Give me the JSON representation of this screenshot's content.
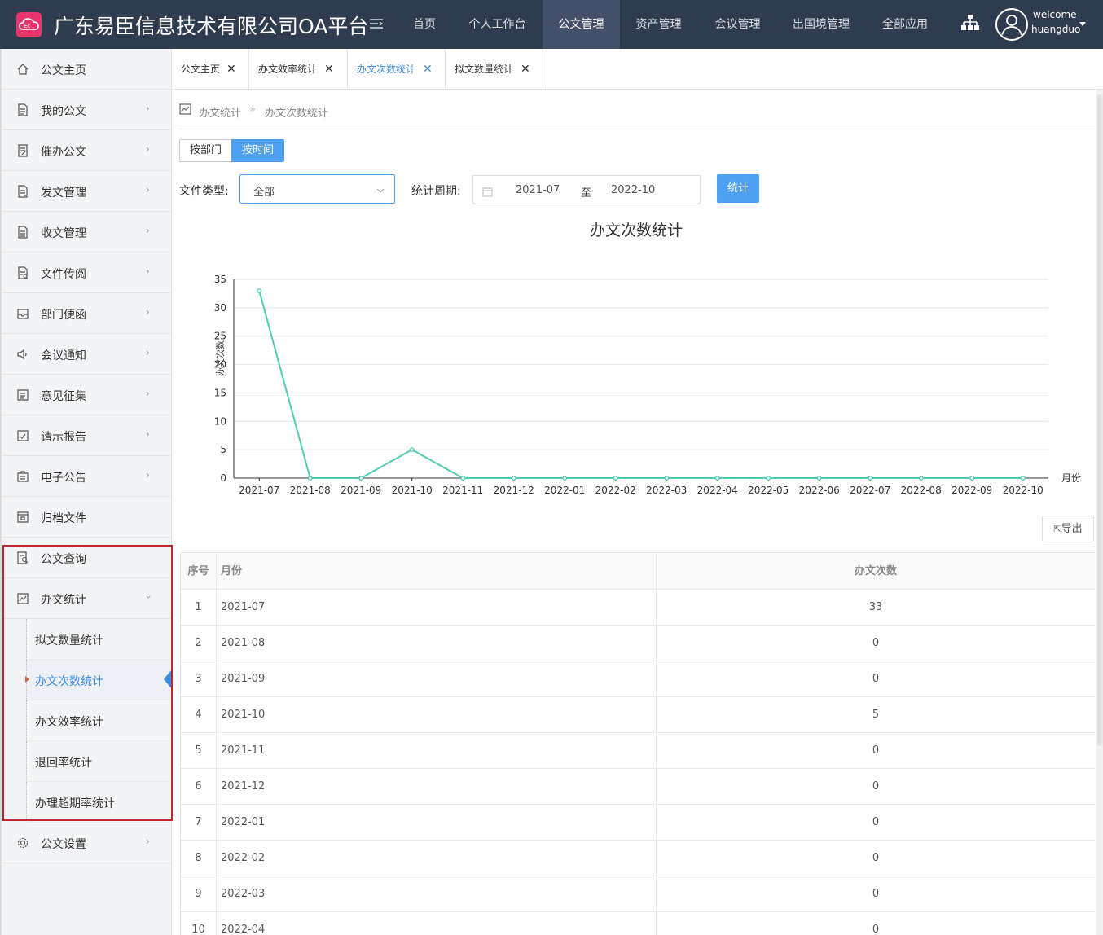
{
  "header": {
    "title": "广东易臣信息技术有限公司OA平台",
    "logo_text": "Ec",
    "nav": [
      "首页",
      "个人工作台",
      "公文管理",
      "资产管理",
      "会议管理",
      "出国境管理",
      "全部应用"
    ],
    "active_nav": "公文管理",
    "welcome": "welcome",
    "username": "huangduo"
  },
  "sidebar": {
    "items": [
      {
        "label": "公文主页",
        "icon": "home-icon"
      },
      {
        "label": "我的公文",
        "icon": "document-icon"
      },
      {
        "label": "催办公文",
        "icon": "edit-document-icon"
      },
      {
        "label": "发文管理",
        "icon": "send-document-icon"
      },
      {
        "label": "收文管理",
        "icon": "receive-document-icon"
      },
      {
        "label": "文件传阅",
        "icon": "circulate-icon"
      },
      {
        "label": "部门便函",
        "icon": "inbox-icon"
      },
      {
        "label": "会议通知",
        "icon": "speaker-icon"
      },
      {
        "label": "意见征集",
        "icon": "list-icon"
      },
      {
        "label": "请示报告",
        "icon": "report-icon"
      },
      {
        "label": "电子公告",
        "icon": "bulletin-icon"
      },
      {
        "label": "归档文件",
        "icon": "archive-icon"
      },
      {
        "label": "公文查询",
        "icon": "search-document-icon"
      },
      {
        "label": "办文统计",
        "icon": "chart-icon"
      }
    ],
    "stats_sub": [
      "拟文数量统计",
      "办文次数统计",
      "办文效率统计",
      "退回率统计",
      "办理超期率统计"
    ],
    "active_sub": "办文次数统计",
    "settings": "公文设置"
  },
  "tabs": [
    {
      "label": "公文主页"
    },
    {
      "label": "办文效率统计"
    },
    {
      "label": "办文次数统计"
    },
    {
      "label": "拟文数量统计"
    }
  ],
  "active_tab": "办文次数统计",
  "breadcrumb": {
    "parent": "办文统计",
    "separator": "»",
    "current": "办文次数统计"
  },
  "segmented": {
    "options": [
      "按部门",
      "按时间"
    ],
    "active": "按时间"
  },
  "filters": {
    "type_label": "文件类型:",
    "type_value": "全部",
    "period_label": "统计周期:",
    "start": "2021-07",
    "to": "至",
    "end": "2022-10",
    "button": "统计"
  },
  "export_label": "导出",
  "chart_data": {
    "type": "line",
    "title": "办文次数统计",
    "ylabel": "办文次数",
    "xlabel": "月份",
    "ylim": [
      0,
      35
    ],
    "yticks": [
      0,
      5,
      10,
      15,
      20,
      25,
      30,
      35
    ],
    "categories": [
      "2021-07",
      "2021-08",
      "2021-09",
      "2021-10",
      "2021-11",
      "2021-12",
      "2022-01",
      "2022-02",
      "2022-03",
      "2022-04",
      "2022-05",
      "2022-06",
      "2022-07",
      "2022-08",
      "2022-09",
      "2022-10"
    ],
    "series": [
      {
        "values": [
          33,
          0,
          0,
          5,
          0,
          0,
          0,
          0,
          0,
          0,
          0,
          0,
          0,
          0,
          0,
          0
        ]
      }
    ],
    "color": "#4ecdb0",
    "grid": true
  },
  "table": {
    "headers": [
      "序号",
      "月份",
      "办文次数"
    ],
    "rows": [
      [
        "1",
        "2021-07",
        "33"
      ],
      [
        "2",
        "2021-08",
        "0"
      ],
      [
        "3",
        "2021-09",
        "0"
      ],
      [
        "4",
        "2021-10",
        "5"
      ],
      [
        "5",
        "2021-11",
        "0"
      ],
      [
        "6",
        "2021-12",
        "0"
      ],
      [
        "7",
        "2022-01",
        "0"
      ],
      [
        "8",
        "2022-02",
        "0"
      ],
      [
        "9",
        "2022-03",
        "0"
      ],
      [
        "10",
        "2022-04",
        "0"
      ]
    ]
  }
}
